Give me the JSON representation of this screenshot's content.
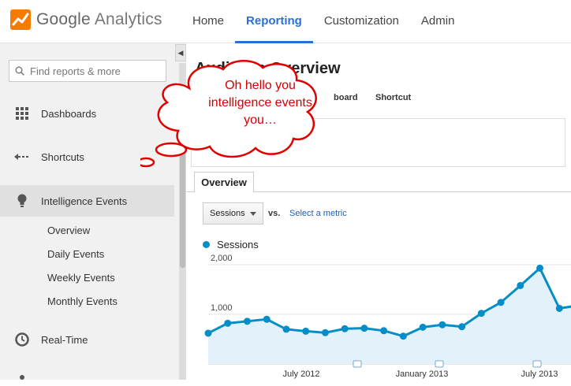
{
  "app": {
    "brand_google": "Google",
    "brand_product": "Analytics"
  },
  "nav": {
    "tabs": [
      {
        "label": "Home",
        "active": false
      },
      {
        "label": "Reporting",
        "active": true
      },
      {
        "label": "Customization",
        "active": false
      },
      {
        "label": "Admin",
        "active": false
      }
    ]
  },
  "sidebar": {
    "search_placeholder": "Find reports & more",
    "items": [
      {
        "label": "Dashboards",
        "icon": "grid-icon"
      },
      {
        "label": "Shortcuts",
        "icon": "shortcut-arrow-icon"
      },
      {
        "label": "Intelligence Events",
        "icon": "lightbulb-icon",
        "active": true
      },
      {
        "label": "Real-Time",
        "icon": "clock-icon"
      }
    ],
    "sub_items": [
      "Overview",
      "Daily Events",
      "Weekly Events",
      "Monthly Events"
    ]
  },
  "main": {
    "title": "Audience Overview",
    "toolbar_partial": "board",
    "toolbar_shortcut": "Shortcut",
    "tab": "Overview",
    "metric_select": "Sessions",
    "vs": "vs.",
    "select_metric_link": "Select a metric",
    "legend": "Sessions"
  },
  "callout": {
    "lines": [
      "Oh hello you",
      "intelligence events",
      "you…"
    ],
    "color": "#d40000"
  },
  "chart_data": {
    "type": "area",
    "series": [
      {
        "name": "Sessions",
        "color": "#058dc7",
        "values": [
          620,
          820,
          860,
          900,
          700,
          660,
          630,
          710,
          720,
          670,
          560,
          740,
          790,
          750,
          1020,
          1240,
          1580,
          1930,
          1120,
          1180
        ]
      }
    ],
    "ylim": [
      0,
      2500
    ],
    "yticks": [
      "2,000",
      "1,000"
    ],
    "xtick_labels": [
      "July 2012",
      "January 2013",
      "July 2013"
    ],
    "annotation_markers": 3
  }
}
